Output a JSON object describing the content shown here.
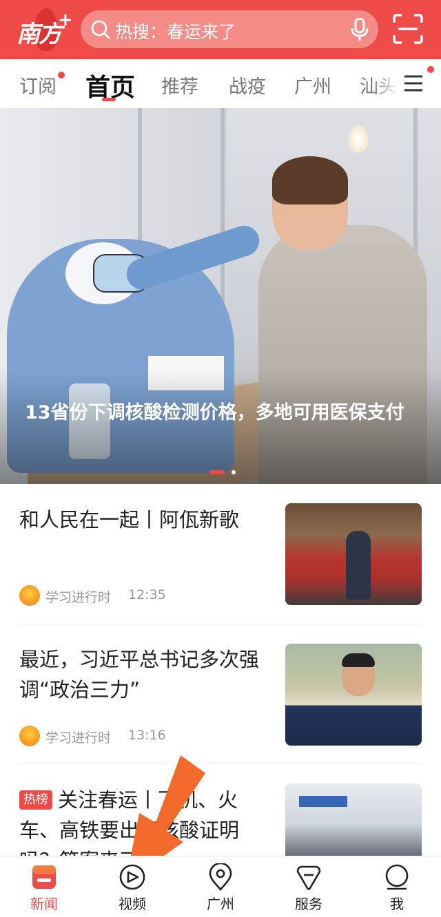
{
  "colors": {
    "brand": "#ee4a48",
    "search_bg": "#f58b87",
    "muted": "#999999",
    "arrow": "#f36a2c"
  },
  "header": {
    "logo_text": "南方",
    "logo_plus": "+",
    "search_text": "热搜：春运来了",
    "icons": [
      "search-icon",
      "mic-icon",
      "scan-icon"
    ]
  },
  "tabs": [
    {
      "label": "订阅",
      "badge": true
    },
    {
      "label": "首页",
      "active": true
    },
    {
      "label": "推荐"
    },
    {
      "label": "战疫"
    },
    {
      "label": "广州"
    },
    {
      "label": "汕头"
    }
  ],
  "menu_badge": true,
  "hero": {
    "title": "13省份下调核酸检测价格，多地可用医保支付",
    "page_count": 2,
    "current_page": 1
  },
  "news": [
    {
      "title": "和人民在一起丨阿佤新歌",
      "source": "学习进行时",
      "time": "12:35"
    },
    {
      "title": "最近，习近平总书记多次强调“政治三力”",
      "source": "学习进行时",
      "time": "13:16"
    },
    {
      "badge": "热榜",
      "title": "关注春运丨飞机、火车、高铁要出示核酸证明吗？答案来了"
    }
  ],
  "bottom_nav": [
    {
      "label": "新闻",
      "icon": "news-icon",
      "active": true
    },
    {
      "label": "视频",
      "icon": "video-icon"
    },
    {
      "label": "广州",
      "icon": "location-icon"
    },
    {
      "label": "服务",
      "icon": "service-icon"
    },
    {
      "label": "我",
      "icon": "profile-icon"
    }
  ]
}
